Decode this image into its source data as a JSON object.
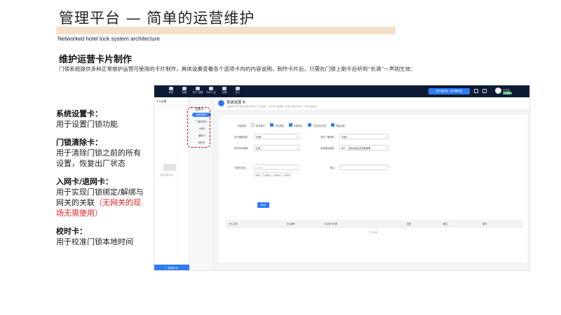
{
  "slide": {
    "title": "管理平台 — 简单的运营维护",
    "subtitle": "Networked hotel lock system architecture",
    "section_heading": "维护运营卡片制作",
    "section_desc": "门锁系统提供多种正常维护运营可使用的卡片制作，具体设置查看各个选项卡内的内容说明，制作卡片后，只需在门锁上刷卡后听到“长滴”一声则生效：",
    "colors": {
      "title_band": "#f6dfc8",
      "warning": "#e02020",
      "highlight_box": "#d0021b",
      "accent": "#2e7cf6"
    }
  },
  "cards": [
    {
      "title": "系统设置卡：",
      "body": "用于设置门锁功能",
      "warning": ""
    },
    {
      "title": "门锁清除卡：",
      "body": "用于清除门锁之前的所有设置，恢复出厂状态",
      "warning": ""
    },
    {
      "title": "入网卡/退网卡：",
      "body": "用于实现门锁绑定/解绑与网关的关联",
      "warning": "（无网关的现场无需使用）"
    },
    {
      "title": "校时卡：",
      "body": "用于校准门锁本地时间",
      "warning": ""
    }
  ],
  "app": {
    "nav": [
      {
        "label": "房态",
        "icon": "home-icon"
      },
      {
        "label": "设备",
        "icon": "device-icon"
      },
      {
        "label": "发卡 设置",
        "icon": "card-icon"
      },
      {
        "label": "PMS入住",
        "icon": "pms-icon"
      },
      {
        "label": "设置",
        "icon": "gear-icon"
      },
      {
        "label": "导入",
        "icon": "import-icon"
      }
    ],
    "top_button": "发卡器未连 · 读卡器未连",
    "user": {
      "name": "王先生",
      "role": "管理员"
    },
    "sidebar": {
      "title": "卡片设置",
      "empty_text": "请先选择卡片",
      "bottom_button": "+ 新增卡片"
    },
    "submenu": {
      "title": "设置卡",
      "items": [
        "系统设置卡",
        "门锁清除卡",
        "入网卡",
        "退网卡",
        "校时卡"
      ],
      "active_index": 0
    },
    "content": {
      "title": "系统设置卡",
      "desc": "系统设置卡用于设置门锁的功能开关、常开模式、房间号等门锁参数，刷卡后门锁听到长滴一声表示设置成功。",
      "lock_settings_label": "门锁设置：",
      "checks": [
        {
          "label": "常开模式",
          "on": false
        },
        {
          "label": "开锁语音",
          "on": true
        },
        {
          "label": "反锁提示",
          "on": true
        },
        {
          "label": "门铃提示开关",
          "on": true
        },
        {
          "label": "防撬功能",
          "on": true
        }
      ],
      "fields": {
        "unlock_volume_label": "低卡提醒音量：",
        "unlock_volume_value": "中音2",
        "broadcast_label": "蓝牙广播频率：",
        "broadcast_value": "中音4",
        "open_time_label": "常开时间间隔：",
        "open_time_value": "正常",
        "sensor_label": "传感器灵敏度：",
        "sensor_value": "NFC · 自然充电后低电量报警",
        "card_count_label": "卡密码长度：",
        "card_count_placeholder": "11000",
        "remark_label": "备注：",
        "chips": [
          "500",
          "1000",
          "2000",
          "5000"
        ],
        "make_button": "制卡"
      },
      "table": {
        "headers": [
          "卡片名称",
          "卡片编号",
          "卡片制卡时间",
          "类型",
          "备注",
          "操作"
        ],
        "empty_text": "暂无数据"
      }
    }
  }
}
